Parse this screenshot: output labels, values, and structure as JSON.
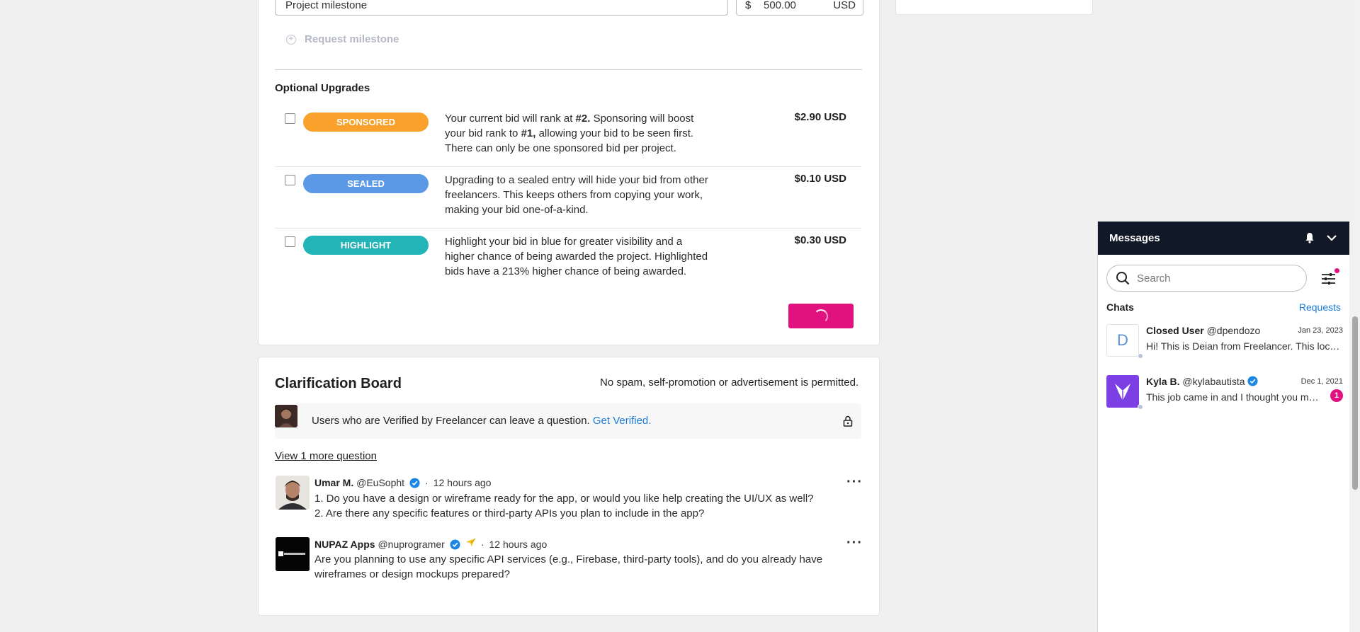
{
  "milestone": {
    "description_value": "Project milestone",
    "currency_symbol": "$",
    "amount_value": "500.00",
    "currency_code": "USD",
    "request_label": "Request milestone"
  },
  "upgrades": {
    "title": "Optional Upgrades",
    "items": [
      {
        "label": "SPONSORED",
        "color": "#f9a12a",
        "desc_a": "Your current bid will rank at ",
        "desc_b": "#2.",
        "desc_c": " Sponsoring will boost your bid rank to ",
        "desc_d": "#1,",
        "desc_e": " allowing your bid to be seen first. There can only be one sponsored bid per project.",
        "price": "$2.90 USD"
      },
      {
        "label": "SEALED",
        "color": "#5b99e6",
        "desc": "Upgrading to a sealed entry will hide your bid from other freelancers. This keeps others from copying your work, making your bid one-of-a-kind.",
        "price": "$0.10 USD"
      },
      {
        "label": "HIGHLIGHT",
        "color": "#22b4b7",
        "desc": "Highlight your bid in blue for greater visibility and a higher chance of being awarded the project. Highlighted bids have a 213% higher chance of being awarded.",
        "price": "$0.30 USD"
      }
    ]
  },
  "board": {
    "title": "Clarification Board",
    "note": "No spam, self-promotion or advertisement is permitted.",
    "verify_text": "Users who are Verified by Freelancer can leave a question.",
    "verify_link": "Get Verified.",
    "view_more": "View 1 more question",
    "questions": [
      {
        "name": "Umar M.",
        "handle": "@EuSopht",
        "time": "12 hours ago",
        "lines": [
          "1. Do you have a design or wireframe ready for the app, or would you like help creating the UI/UX as well?",
          "2. Are there any specific features or third-party APIs you plan to include in the app?"
        ]
      },
      {
        "name": "NUPAZ Apps",
        "handle": "@nuprogramer",
        "time": "12 hours ago",
        "lines": [
          "Are you planning to use any specific API services (e.g., Firebase, third-party tools), and do you already have",
          "wireframes or design mockups prepared?"
        ]
      }
    ]
  },
  "messages": {
    "title": "Messages",
    "search_placeholder": "Search",
    "chats_label": "Chats",
    "requests_label": "Requests",
    "chats": [
      {
        "avatar_letter": "D",
        "name": "Closed User",
        "handle": "@dpendozo",
        "date": "Jan 23, 2023",
        "preview": "Hi! This is Deian from Freelancer. This location is…"
      },
      {
        "name": "Kyla B.",
        "handle": "@kylabautista",
        "date": "Dec 1, 2021",
        "preview": "This job came in and I thought you might be interested",
        "unread": "1"
      }
    ]
  }
}
